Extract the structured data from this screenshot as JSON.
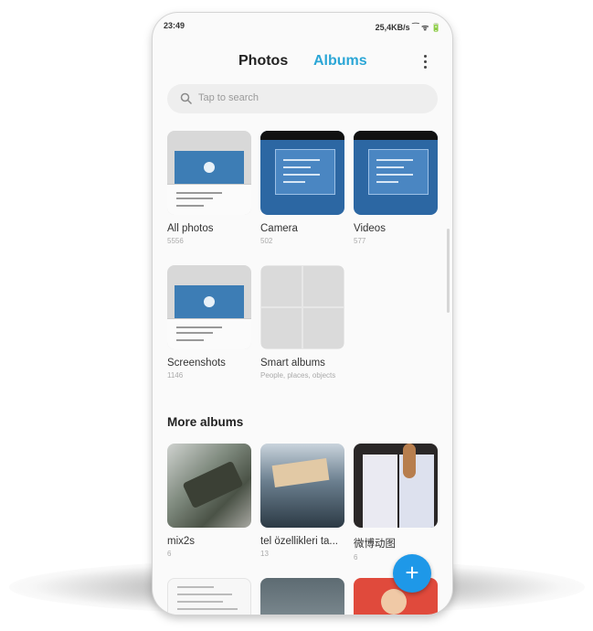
{
  "status_bar": {
    "time": "23:49",
    "indicators": "25,4KB/s ⁀ ᯤ 🔋"
  },
  "tabs": [
    {
      "label": "Photos",
      "active": false
    },
    {
      "label": "Albums",
      "active": true
    }
  ],
  "menu": {
    "icon": "overflow-menu-icon"
  },
  "search": {
    "placeholder": "Tap to search",
    "icon": "search-icon"
  },
  "albums": [
    {
      "title": "All photos",
      "count": "5556"
    },
    {
      "title": "Camera",
      "count": "502"
    },
    {
      "title": "Videos",
      "count": "577"
    },
    {
      "title": "Screenshots",
      "count": "1146"
    },
    {
      "title": "Smart albums",
      "subtitle": "People, places, objects"
    }
  ],
  "more_albums": {
    "heading": "More albums",
    "items": [
      {
        "title": "mix2s",
        "count": "6"
      },
      {
        "title": "tel özellikleri ta...",
        "count": "13"
      },
      {
        "title": "微博动图",
        "count": "6"
      }
    ]
  },
  "fab": {
    "label": "+",
    "icon": "add-icon"
  },
  "colors": {
    "accent": "#2ba6d6",
    "fab": "#1e98e8"
  }
}
